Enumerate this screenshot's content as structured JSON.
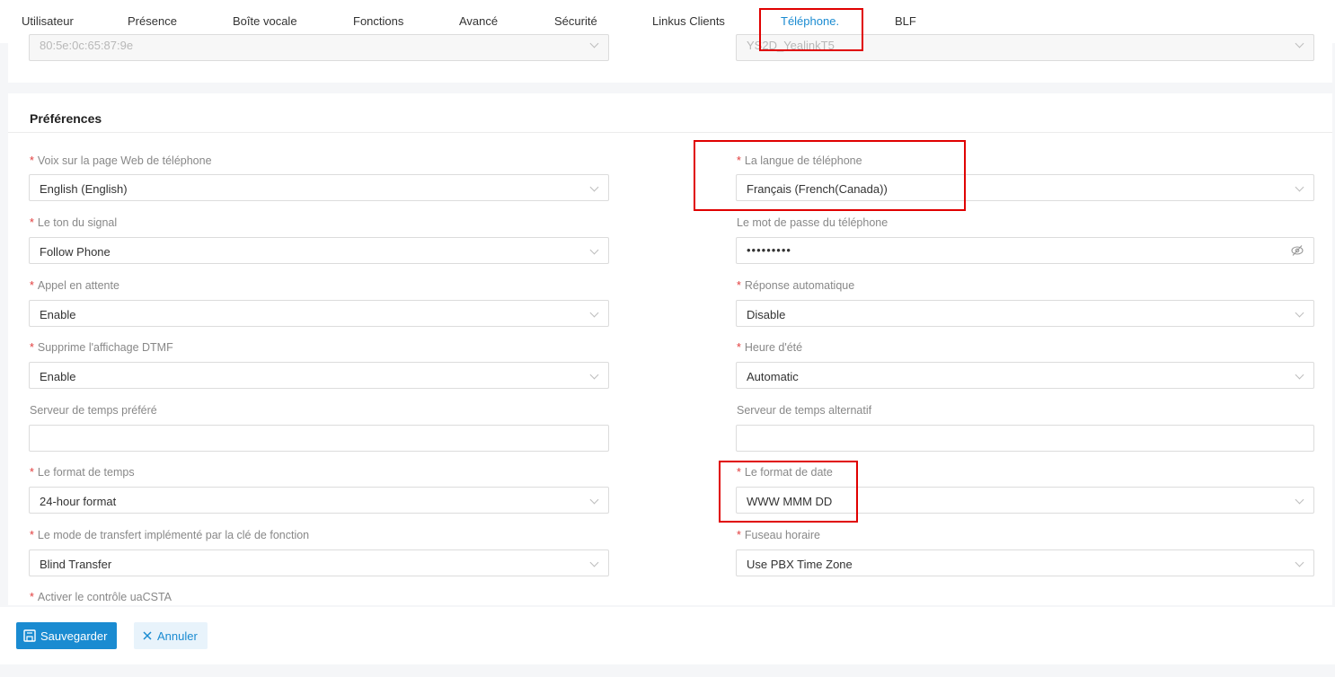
{
  "tabs": [
    {
      "label": "Utilisateur"
    },
    {
      "label": "Présence"
    },
    {
      "label": "Boîte vocale"
    },
    {
      "label": "Fonctions"
    },
    {
      "label": "Avancé"
    },
    {
      "label": "Sécurité"
    },
    {
      "label": "Linkus Clients"
    },
    {
      "label": "Téléphone."
    },
    {
      "label": "BLF"
    }
  ],
  "active_tab": "Téléphone.",
  "top_fields": {
    "mac_address": "80:5e:0c:65:87:9e",
    "model": "YS2D_YealinkT5"
  },
  "preferences": {
    "title": "Préférences",
    "fields": {
      "web_voice": {
        "label": "Voix sur la page Web de téléphone",
        "value": "English (English)"
      },
      "phone_language": {
        "label": "La langue de téléphone",
        "value": "Français (French(Canada))"
      },
      "ring_tone": {
        "label": "Le ton du signal",
        "value": "Follow Phone"
      },
      "phone_password": {
        "label": "Le mot de passe du téléphone",
        "value": "•••••••••"
      },
      "call_waiting": {
        "label": "Appel en attente",
        "value": "Enable"
      },
      "auto_answer": {
        "label": "Réponse automatique",
        "value": "Disable"
      },
      "suppress_dtmf": {
        "label": "Supprime l'affichage DTMF",
        "value": "Enable"
      },
      "dst": {
        "label": "Heure d'été",
        "value": "Automatic"
      },
      "preferred_time_server": {
        "label": "Serveur de temps préféré",
        "value": ""
      },
      "alt_time_server": {
        "label": "Serveur de temps alternatif",
        "value": ""
      },
      "time_format": {
        "label": "Le format de temps",
        "value": "24-hour format"
      },
      "date_format": {
        "label": "Le format de date",
        "value": "WWW MMM DD"
      },
      "transfer_mode": {
        "label": "Le mode de transfert implémenté par la clé de fonction",
        "value": "Blind Transfer"
      },
      "time_zone": {
        "label": "Fuseau horaire",
        "value": "Use PBX Time Zone"
      },
      "uacsta": {
        "label": "Activer le contrôle uaCSTA"
      }
    }
  },
  "buttons": {
    "save": "Sauvegarder",
    "cancel": "Annuler"
  },
  "colors": {
    "accent": "#1a8bd1",
    "required": "#e23c3c",
    "highlight": "#e00000"
  }
}
